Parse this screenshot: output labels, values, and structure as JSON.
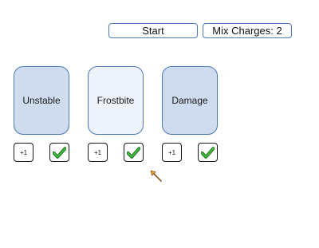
{
  "controls": {
    "start_label": "Start",
    "mix_charges_label": "Mix Charges: 2"
  },
  "cards": [
    {
      "label": "Unstable",
      "selected": true,
      "plus_label": "+1"
    },
    {
      "label": "Frostbite",
      "selected": false,
      "plus_label": "+1"
    },
    {
      "label": "Damage",
      "selected": true,
      "plus_label": "+1"
    }
  ],
  "icons": {
    "confirm": "checkmark-icon",
    "pointer": "pointer-cursor-icon"
  },
  "colors": {
    "card_selected": "#cfdcef",
    "card_unselected": "#eef3fb",
    "border_accent": "#4a78b8",
    "check_green": "#2e9e2e"
  }
}
